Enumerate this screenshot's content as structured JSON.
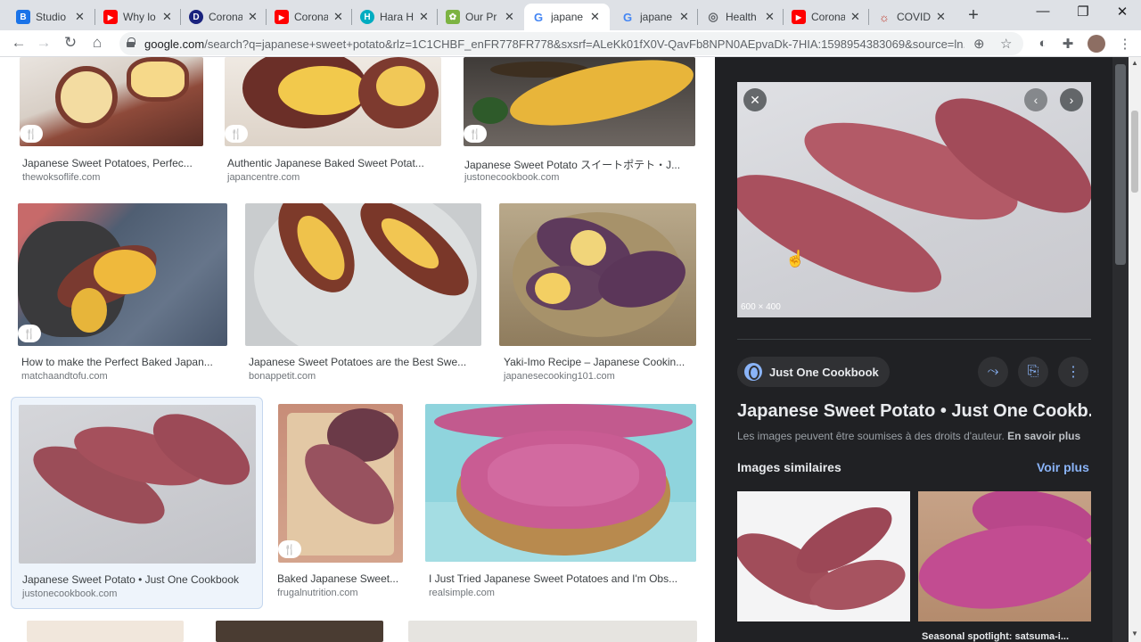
{
  "tabs": [
    {
      "title": "Studio",
      "favicon": "B",
      "color": "#1a73e8"
    },
    {
      "title": "Why lo",
      "favicon": "▶",
      "color": "#ff0000"
    },
    {
      "title": "Corona",
      "favicon": "D",
      "color": "#1a237e"
    },
    {
      "title": "Corona",
      "favicon": "▶",
      "color": "#ff0000"
    },
    {
      "title": "Hara H",
      "favicon": "H",
      "color": "#00acc1"
    },
    {
      "title": "Our Pr",
      "favicon": "✿",
      "color": "#7cb342"
    },
    {
      "title": "japane",
      "favicon": "G",
      "color": "#4285f4"
    },
    {
      "title": "japane",
      "favicon": "G",
      "color": "#4285f4"
    },
    {
      "title": "Health",
      "favicon": "◎",
      "color": "#5f6368"
    },
    {
      "title": "Corona",
      "favicon": "▶",
      "color": "#ff0000"
    },
    {
      "title": "COVID-",
      "favicon": "☼",
      "color": "#c0392b"
    }
  ],
  "toolbar": {
    "url_host": "google.com",
    "url_path": "/search?q=japanese+sweet+potato&rlz=1C1CHBF_enFR778FR778&sxsrf=ALeKk01fX0V-QavFb8NPN0AEpvaDk-7HIA:1598954383069&source=ln..."
  },
  "results": [
    {
      "title": "Japanese Sweet Potatoes, Perfec...",
      "source": "thewoksoflife.com",
      "recipe": true,
      "badge": "🍴"
    },
    {
      "title": "Authentic Japanese Baked Sweet Potat...",
      "source": "japancentre.com",
      "recipe": true,
      "badge": "🍴"
    },
    {
      "title": "Japanese Sweet Potato スイートポテト・J...",
      "source": "justonecookbook.com",
      "recipe": true,
      "badge": "🍴"
    },
    {
      "title": "How to make the Perfect Baked Japan...",
      "source": "matchaandtofu.com",
      "recipe": true,
      "badge": "🍴"
    },
    {
      "title": "Japanese Sweet Potatoes are the Best Swe...",
      "source": "bonappetit.com",
      "recipe": false
    },
    {
      "title": "Yaki-Imo Recipe – Japanese Cookin...",
      "source": "japanesecooking101.com",
      "recipe": false
    },
    {
      "title": "Japanese Sweet Potato • Just One Cookbook",
      "source": "justonecookbook.com",
      "recipe": false,
      "selected": true
    },
    {
      "title": "Baked Japanese Sweet...",
      "source": "frugalnutrition.com",
      "recipe": true,
      "badge": "🍴"
    },
    {
      "title": "I Just Tried Japanese Sweet Potatoes and I'm Obs...",
      "source": "realsimple.com",
      "recipe": false
    }
  ],
  "panel": {
    "image_dims": "600 × 400",
    "source_name": "Just One Cookbook",
    "title": "Japanese Sweet Potato • Just One Cookb...",
    "copyright": "Les images peuvent être soumises à des droits d'auteur.",
    "learn_more": "En savoir plus",
    "similar_header": "Images similaires",
    "see_more": "Voir plus",
    "similar_caption": "Seasonal spotlight: satsuma-i..."
  },
  "colors": {
    "accent": "#8ab4f8",
    "panel_bg": "#202124",
    "potato_skin": "#a8465e",
    "potato_flesh": "#f2c94c"
  }
}
